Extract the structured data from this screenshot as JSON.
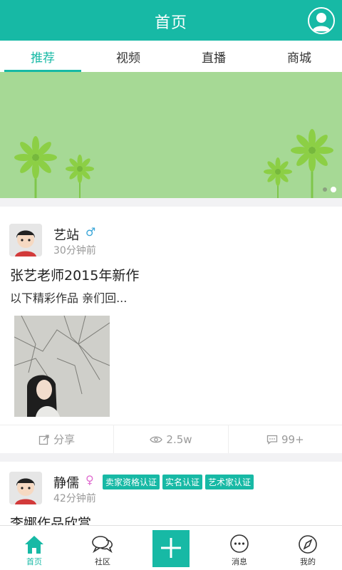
{
  "header": {
    "title": "首页",
    "profile_icon": "user-avatar-icon"
  },
  "tabs": [
    {
      "label": "推荐",
      "active": true
    },
    {
      "label": "视频",
      "active": false
    },
    {
      "label": "直播",
      "active": false
    },
    {
      "label": "商城",
      "active": false
    }
  ],
  "banner": {
    "slides": 2,
    "active_slide": 2
  },
  "posts": [
    {
      "username": "艺站",
      "gender": "♂",
      "time": "30分钟前",
      "title": "张艺老师2015年新作",
      "desc": "以下精彩作品 亲们回...",
      "share_label": "分享",
      "views": "2.5w",
      "comments": "99+"
    },
    {
      "username": "静儒",
      "gender": "♀",
      "time": "42分钟前",
      "badges": [
        "卖家资格认证",
        "实名认证",
        "艺术家认证"
      ],
      "title": "李娜作品欣赏"
    }
  ],
  "bottom_nav": [
    {
      "label": "首页",
      "icon": "home-icon",
      "active": true
    },
    {
      "label": "社区",
      "icon": "community-icon",
      "active": false
    },
    {
      "label": "",
      "icon": "plus-icon",
      "active": false
    },
    {
      "label": "消息",
      "icon": "message-icon",
      "active": false
    },
    {
      "label": "我的",
      "icon": "compass-icon",
      "active": false
    }
  ],
  "colors": {
    "accent": "#17b9a5",
    "banner": "#a6d995",
    "male": "#3aa6d8",
    "female": "#e06ed0"
  }
}
